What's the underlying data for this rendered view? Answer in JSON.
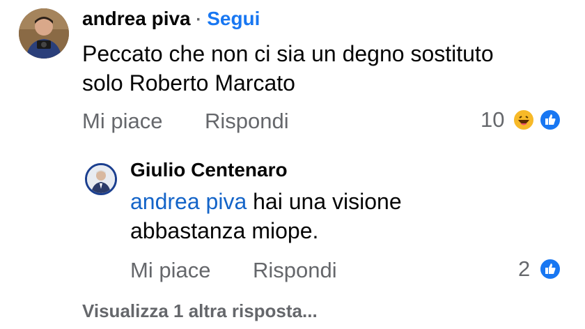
{
  "comment": {
    "author": "andrea piva",
    "separator": "·",
    "follow_label": "Segui",
    "text_line1": "Peccato che non ci sia un degno sostituto",
    "text_line2": "solo Roberto Marcato",
    "like_label": "Mi piace",
    "reply_label": "Rispondi",
    "reactions_count": "10",
    "reaction_icons": [
      "haha-icon",
      "like-icon"
    ]
  },
  "reply": {
    "author": "Giulio Centenaro",
    "mention": "andrea piva",
    "text_line1_rest": " hai una visione",
    "text_line2": "abbastanza miope.",
    "like_label": "Mi piace",
    "reply_label": "Rispondi",
    "reactions_count": "2",
    "reaction_icons": [
      "like-icon"
    ]
  },
  "more_replies_label": "Visualizza 1 altra risposta...",
  "colors": {
    "link_blue": "#1877f2",
    "mention_blue": "#1464c8",
    "secondary_gray": "#65676b",
    "text": "#050505",
    "haha_yellow": "#f7b928"
  }
}
